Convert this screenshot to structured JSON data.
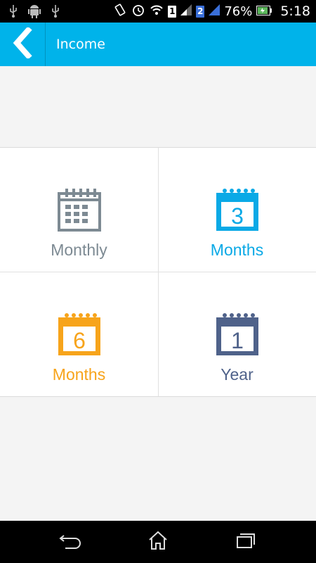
{
  "status_bar": {
    "battery": "76%",
    "time": "5:18",
    "sim1": "1",
    "sim2": "2"
  },
  "header": {
    "title": "Income"
  },
  "options": [
    {
      "number": "",
      "label": "Monthly",
      "color": "#7d8a93",
      "icon": "calendar-grid-icon"
    },
    {
      "number": "3",
      "label": "Months",
      "color": "#0aa9e6",
      "icon": "calendar-3-icon"
    },
    {
      "number": "6",
      "label": "Months",
      "color": "#f7a41b",
      "icon": "calendar-6-icon"
    },
    {
      "number": "1",
      "label": "Year",
      "color": "#4f628a",
      "icon": "calendar-1-icon"
    }
  ],
  "nav": {
    "icons": [
      "back-icon",
      "home-icon",
      "recents-icon"
    ]
  }
}
